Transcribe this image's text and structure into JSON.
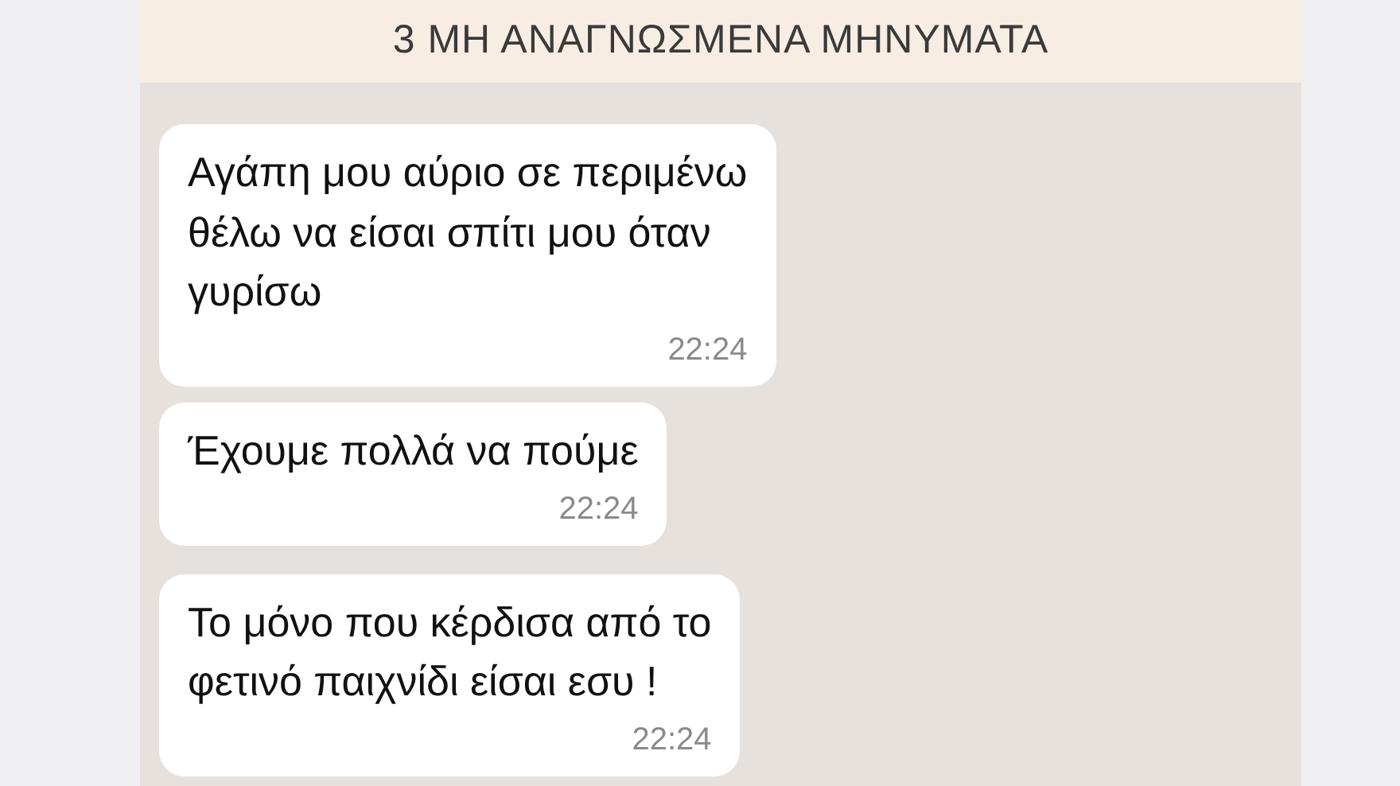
{
  "header": {
    "title": "3 ΜΗ ΑΝΑΓΝΩΣΜΕΝΑ ΜΗΝΥΜΑΤΑ"
  },
  "messages": [
    {
      "text": "Αγάπη μου αύριο σε περιμένω\nθέλω να είσαι σπίτι μου όταν\nγυρίσω",
      "time": "22:24"
    },
    {
      "text": "Έχουμε πολλά να πούμε",
      "time": "22:24"
    },
    {
      "text": "Το μόνο που κέρδισα από το\nφετινό παιχνίδι είσαι εσυ !",
      "time": "22:24"
    }
  ]
}
